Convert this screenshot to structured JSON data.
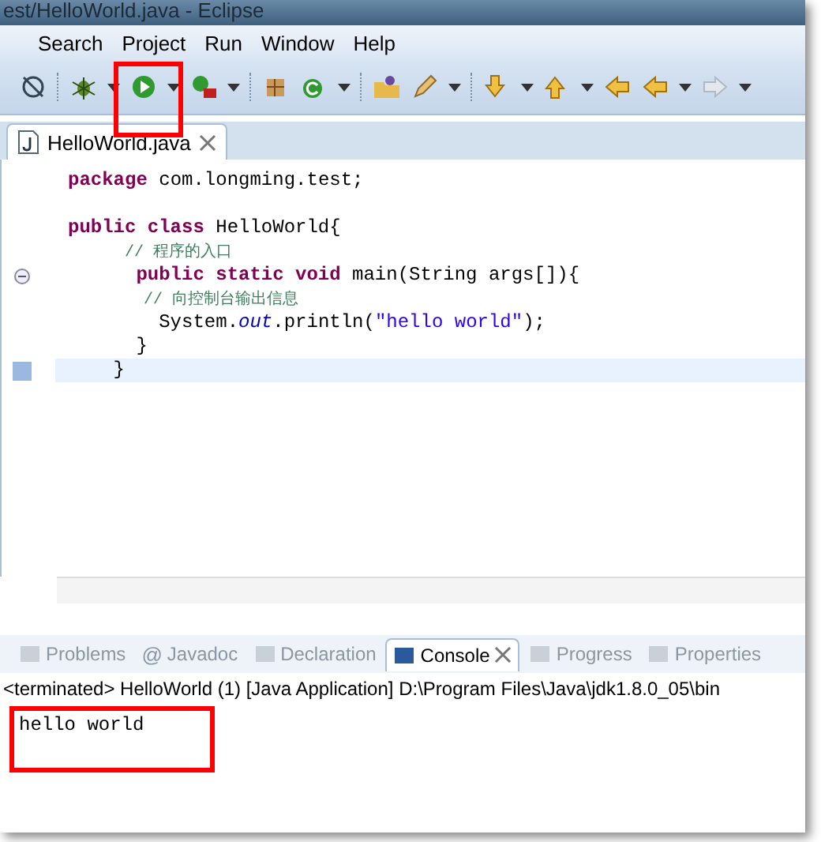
{
  "window": {
    "title": "est/HelloWorld.java - Eclipse"
  },
  "menu": [
    {
      "label": "Search"
    },
    {
      "label": "Project"
    },
    {
      "label": "Run"
    },
    {
      "label": "Window"
    },
    {
      "label": "Help"
    }
  ],
  "editor": {
    "tab": {
      "label": "HelloWorld.java",
      "selected": true
    },
    "lines": [
      {
        "current": false,
        "segments": [
          {
            "kind": "keyword",
            "text": "package"
          },
          {
            "kind": "plain",
            "text": " com.longming.test;"
          }
        ]
      },
      {
        "current": false
      },
      {
        "current": false,
        "segments": [
          {
            "kind": "keyword",
            "text": "public class"
          },
          {
            "kind": "plain",
            "text": " HelloWorld{"
          }
        ]
      },
      {
        "current": false,
        "segments": [
          {
            "kind": "comment",
            "text": "      // 程序的入口"
          }
        ]
      },
      {
        "current": false,
        "segments": [
          {
            "kind": "keyword",
            "text": "      public static void"
          },
          {
            "kind": "plain",
            "text": " main(String args[]){"
          }
        ]
      },
      {
        "current": false,
        "segments": [
          {
            "kind": "comment",
            "text": "        // 向控制台输出信息"
          }
        ]
      },
      {
        "current": false,
        "segments": [
          {
            "kind": "plain",
            "text": "        System."
          },
          {
            "kind": "field",
            "text": "out"
          },
          {
            "kind": "plain",
            "text": ".println("
          },
          {
            "kind": "string",
            "text": "\"hello world\""
          },
          {
            "kind": "plain",
            "text": ");"
          }
        ]
      },
      {
        "current": false,
        "segments": [
          {
            "kind": "plain",
            "text": "      }"
          }
        ]
      },
      {
        "current": true,
        "segments": [
          {
            "kind": "plain",
            "text": "    }"
          }
        ]
      }
    ]
  },
  "panel": {
    "tabs": [
      {
        "label": "Problems",
        "selected": false
      },
      {
        "label": "Javadoc",
        "glyph": "@",
        "selected": false
      },
      {
        "label": "Declaration",
        "selected": false
      },
      {
        "label": "Console",
        "selected": true
      },
      {
        "label": "Progress",
        "selected": false
      },
      {
        "label": "Properties",
        "selected": false
      }
    ],
    "console_header": "<terminated> HelloWorld (1) [Java Application] D:\\Program Files\\Java\\jdk1.8.0_05\\bin",
    "output": "hello world"
  }
}
